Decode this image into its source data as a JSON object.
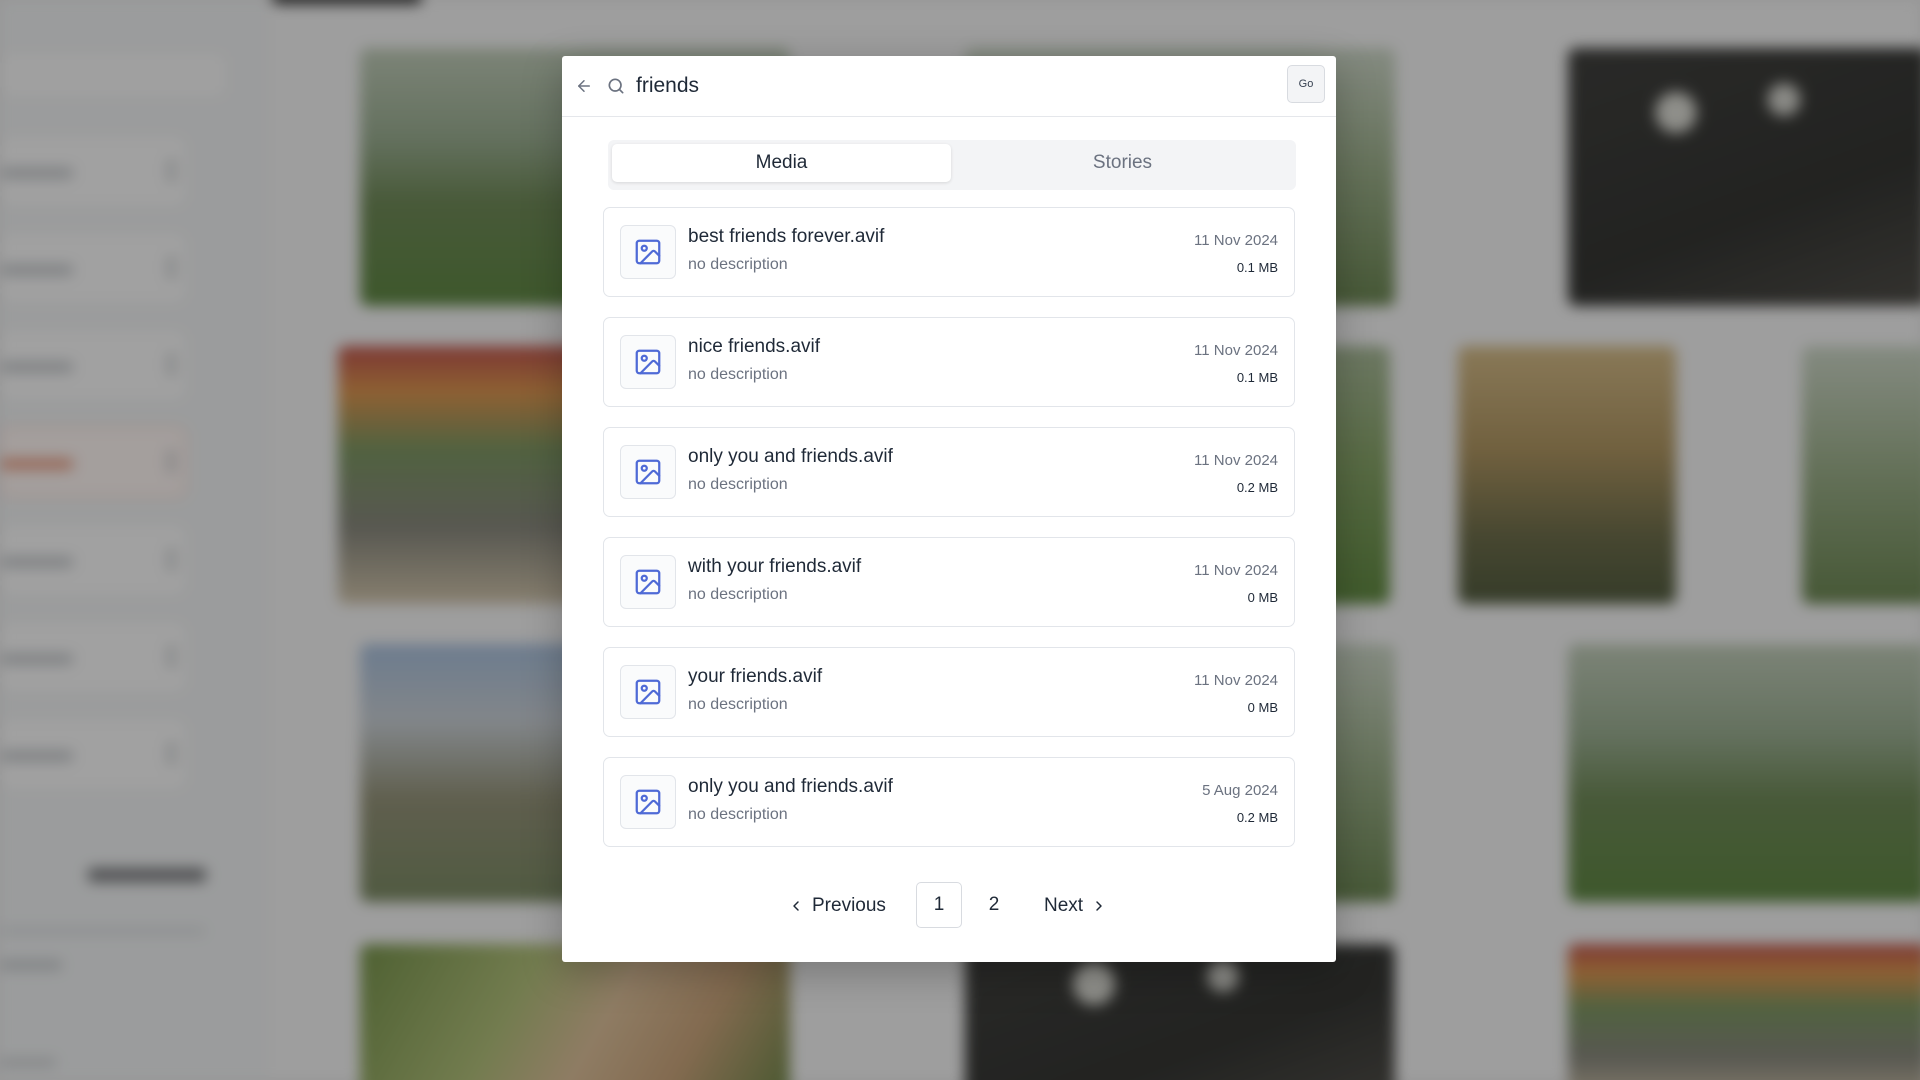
{
  "search": {
    "query": "friends",
    "go_label": "Go"
  },
  "tabs": [
    {
      "label": "Media",
      "active": true
    },
    {
      "label": "Stories",
      "active": false
    }
  ],
  "results": [
    {
      "name": "best friends forever.avif",
      "description": "no description",
      "date": "11 Nov 2024",
      "size": "0.1 MB"
    },
    {
      "name": "nice friends.avif",
      "description": "no description",
      "date": "11 Nov 2024",
      "size": "0.1 MB"
    },
    {
      "name": "only you and friends.avif",
      "description": "no description",
      "date": "11 Nov 2024",
      "size": "0.2 MB"
    },
    {
      "name": "with your friends.avif",
      "description": "no description",
      "date": "11 Nov 2024",
      "size": "0 MB"
    },
    {
      "name": "your friends.avif",
      "description": "no description",
      "date": "11 Nov 2024",
      "size": "0 MB"
    },
    {
      "name": "only you and friends.avif",
      "description": "no description",
      "date": "5 Aug 2024",
      "size": "0.2 MB"
    }
  ],
  "pagination": {
    "previous_label": "Previous",
    "next_label": "Next",
    "pages": [
      "1",
      "2"
    ],
    "current": "1"
  },
  "icons": {
    "back": "arrow-left-icon",
    "search": "search-icon",
    "thumbnail": "image-icon",
    "prev": "chevron-left-icon",
    "next": "chevron-right-icon"
  },
  "colors": {
    "accent": "#4f6ad6",
    "text": "#1f2937",
    "muted": "#6b7280"
  }
}
